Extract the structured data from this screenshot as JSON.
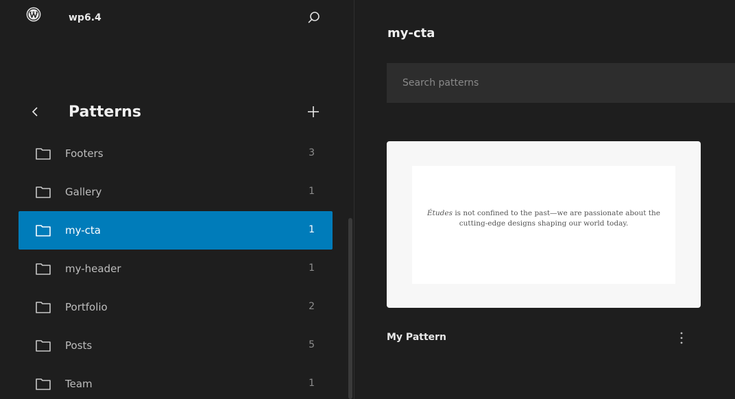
{
  "site": {
    "name": "wp6.4"
  },
  "sidebar": {
    "title": "Patterns",
    "items": [
      {
        "label": "Footers",
        "count": "3",
        "active": false
      },
      {
        "label": "Gallery",
        "count": "1",
        "active": false
      },
      {
        "label": "my-cta",
        "count": "1",
        "active": true
      },
      {
        "label": "my-header",
        "count": "1",
        "active": false
      },
      {
        "label": "Portfolio",
        "count": "2",
        "active": false
      },
      {
        "label": "Posts",
        "count": "5",
        "active": false
      },
      {
        "label": "Team",
        "count": "1",
        "active": false
      }
    ]
  },
  "main": {
    "title": "my-cta",
    "search_placeholder": "Search patterns",
    "pattern": {
      "preview_emphasis": "Études",
      "preview_text": " is not confined to the past—we are passionate about the cutting-edge designs shaping our world today.",
      "name": "My Pattern"
    }
  },
  "colors": {
    "accent": "#007cba",
    "background": "#1e1e1e",
    "search_bg": "#2d2d2d"
  }
}
